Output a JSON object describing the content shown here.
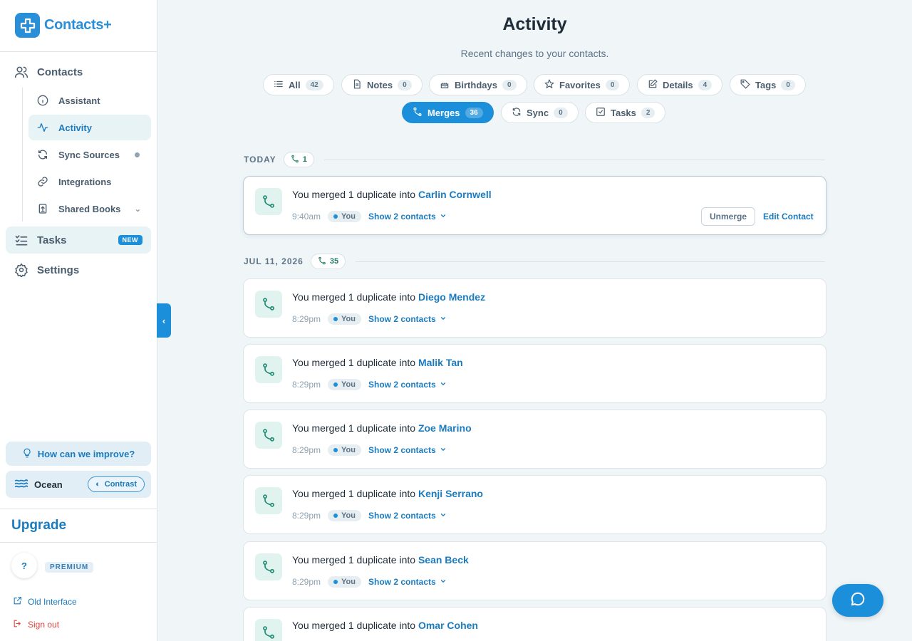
{
  "app": {
    "name": "Contacts+"
  },
  "sidebar": {
    "contacts_label": "Contacts",
    "sub_items": [
      {
        "label": "Assistant",
        "icon": "info-icon"
      },
      {
        "label": "Activity",
        "icon": "activity-icon",
        "active": true
      },
      {
        "label": "Sync Sources",
        "icon": "sync-icon"
      },
      {
        "label": "Integrations",
        "icon": "link-icon"
      },
      {
        "label": "Shared Books",
        "icon": "shared-book-icon"
      }
    ],
    "tasks_label": "Tasks",
    "tasks_badge": "NEW",
    "settings_label": "Settings",
    "improve_label": "How can we improve?",
    "theme_label": "Ocean",
    "contrast_label": "Contrast",
    "upgrade_label": "Upgrade",
    "avatar_initial": "?",
    "plan_label": "PREMIUM",
    "old_interface_label": "Old Interface",
    "signout_label": "Sign out"
  },
  "main": {
    "title": "Activity",
    "subtitle": "Recent changes to your contacts.",
    "filters": [
      {
        "label": "All",
        "count": "42",
        "icon": "list-icon"
      },
      {
        "label": "Notes",
        "count": "0",
        "icon": "note-icon"
      },
      {
        "label": "Birthdays",
        "count": "0",
        "icon": "cake-icon"
      },
      {
        "label": "Favorites",
        "count": "0",
        "icon": "star-icon"
      },
      {
        "label": "Details",
        "count": "4",
        "icon": "edit-icon"
      },
      {
        "label": "Tags",
        "count": "0",
        "icon": "tag-icon"
      },
      {
        "label": "Merges",
        "count": "36",
        "icon": "merge-icon",
        "active": true
      },
      {
        "label": "Sync",
        "count": "0",
        "icon": "sync-icon"
      },
      {
        "label": "Tasks",
        "count": "2",
        "icon": "task-icon"
      }
    ],
    "groups": [
      {
        "date": "TODAY",
        "count": "1",
        "items": [
          {
            "prefix": "You merged 1 duplicate into ",
            "name": "Carlin Cornwell",
            "time": "9:40am",
            "actor": "You",
            "show": "Show 2 contacts",
            "unmerge": "Unmerge",
            "edit": "Edit Contact"
          }
        ]
      },
      {
        "date": "JUL 11, 2026",
        "count": "35",
        "items": [
          {
            "prefix": "You merged 1 duplicate into ",
            "name": "Diego Mendez",
            "time": "8:29pm",
            "actor": "You",
            "show": "Show 2 contacts"
          },
          {
            "prefix": "You merged 1 duplicate into ",
            "name": "Malik Tan",
            "time": "8:29pm",
            "actor": "You",
            "show": "Show 2 contacts"
          },
          {
            "prefix": "You merged 1 duplicate into ",
            "name": "Zoe Marino",
            "time": "8:29pm",
            "actor": "You",
            "show": "Show 2 contacts"
          },
          {
            "prefix": "You merged 1 duplicate into ",
            "name": "Kenji Serrano",
            "time": "8:29pm",
            "actor": "You",
            "show": "Show 2 contacts"
          },
          {
            "prefix": "You merged 1 duplicate into ",
            "name": "Sean Beck",
            "time": "8:29pm",
            "actor": "You",
            "show": "Show 2 contacts"
          },
          {
            "prefix": "You merged 1 duplicate into ",
            "name": "Omar Cohen",
            "time": "",
            "actor": "",
            "show": ""
          }
        ]
      }
    ]
  },
  "colors": {
    "accent": "#1b8fd9",
    "merge_icon": "#1f8a72",
    "danger": "#e0443a"
  }
}
